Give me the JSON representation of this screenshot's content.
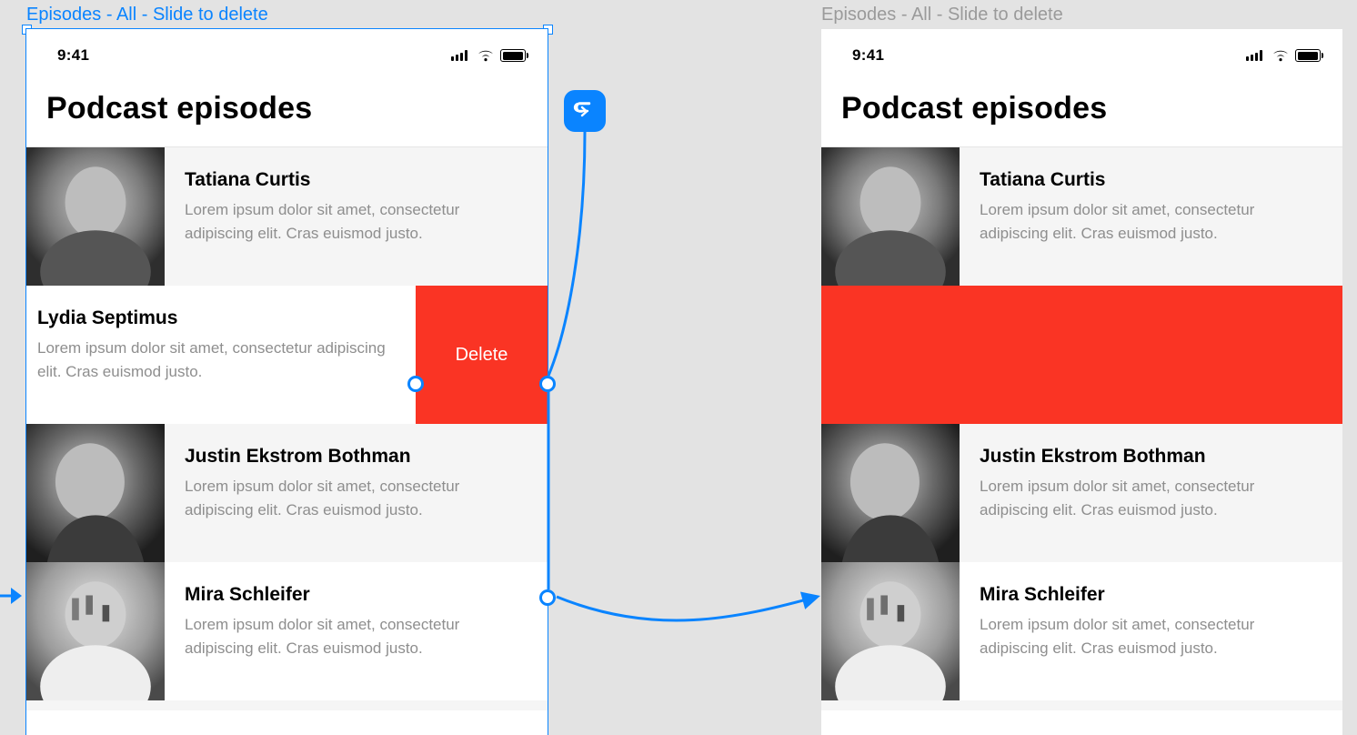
{
  "frames": {
    "left_label": "Episodes - All - Slide to delete",
    "right_label": "Episodes - All - Slide to delete"
  },
  "statusbar": {
    "time": "9:41"
  },
  "header": {
    "title": "Podcast episodes"
  },
  "episodes": {
    "desc": "Lorem ipsum dolor sit amet, consectetur adipiscing elit. Cras euismod justo.",
    "items": [
      {
        "name": "Tatiana Curtis"
      },
      {
        "name": "Lydia Septimus"
      },
      {
        "name": "Justin Ekstrom Bothman"
      },
      {
        "name": "Mira Schleifer"
      }
    ]
  },
  "actions": {
    "delete_label": "Delete"
  },
  "colors": {
    "accent": "#0A84FF",
    "danger": "#FA3424"
  }
}
